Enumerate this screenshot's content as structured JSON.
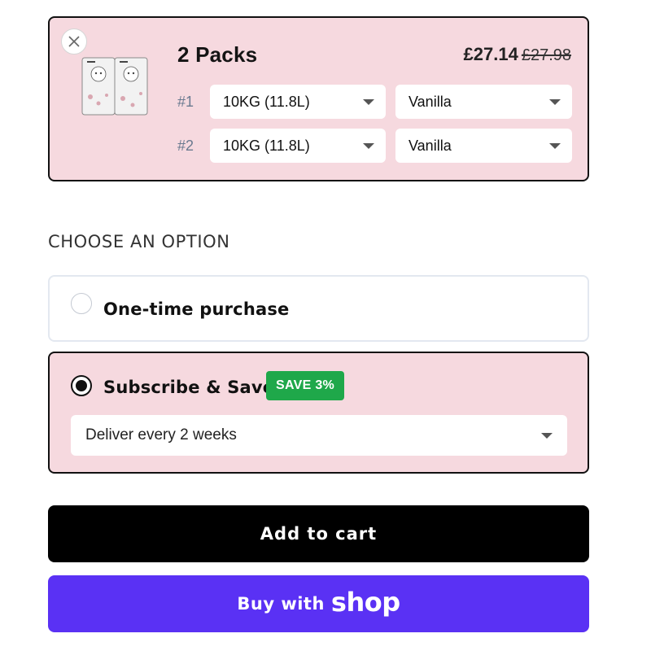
{
  "bundle": {
    "title": "2 Packs",
    "price_current": "£27.14",
    "price_original": "£27.98",
    "variants": [
      {
        "index": "#1",
        "size": "10KG (11.8L)",
        "flavor": "Vanilla"
      },
      {
        "index": "#2",
        "size": "10KG (11.8L)",
        "flavor": "Vanilla"
      }
    ]
  },
  "options": {
    "heading": "CHOOSE AN OPTION",
    "one_time": {
      "label": "One-time purchase",
      "selected": false
    },
    "subscribe": {
      "label": "Subscribe & Save",
      "badge": "SAVE 3%",
      "selected": true,
      "frequency": "Deliver every 2 weeks"
    }
  },
  "actions": {
    "add_to_cart": "Add to cart",
    "buy_with": "Buy with",
    "shop_brand": "shop"
  },
  "colors": {
    "card_bg": "#f6d9df",
    "badge_green": "#1fa84a",
    "shop_purple": "#5a31f4",
    "cart_black": "#000000"
  }
}
